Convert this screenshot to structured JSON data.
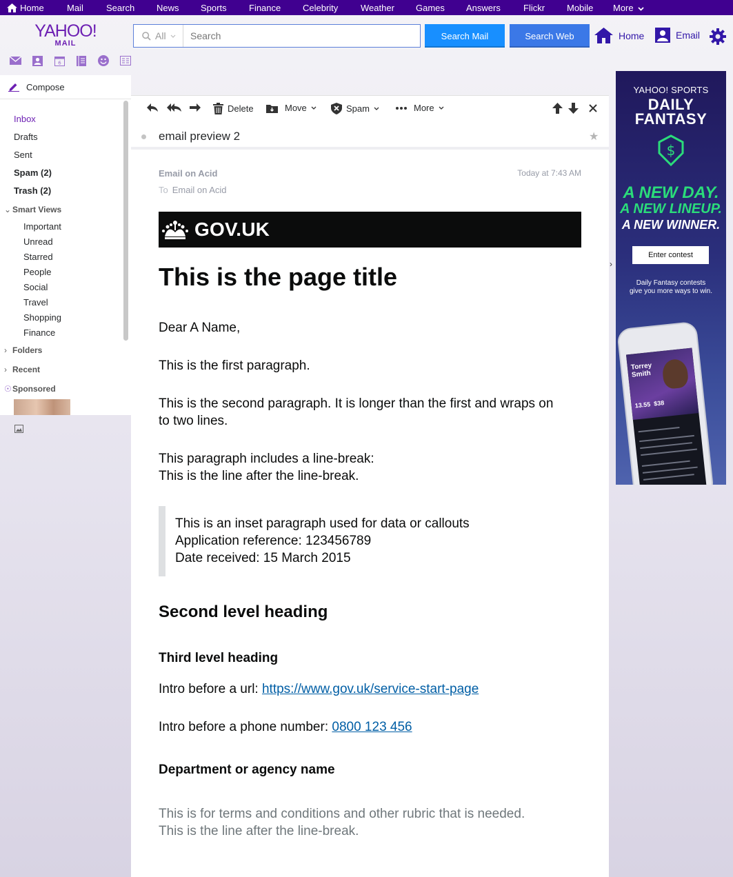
{
  "nav": {
    "items": [
      "Home",
      "Mail",
      "Search",
      "News",
      "Sports",
      "Finance",
      "Celebrity",
      "Weather",
      "Games",
      "Answers",
      "Flickr",
      "Mobile",
      "More"
    ]
  },
  "logo": {
    "line1": "YAHOO!",
    "line2": "MAIL"
  },
  "search": {
    "scope": "All",
    "placeholder": "Search",
    "value": ""
  },
  "header": {
    "search_mail": "Search Mail",
    "search_web": "Search Web",
    "home": "Home",
    "email": "Email"
  },
  "apps": [
    "mail-icon",
    "contacts-icon",
    "calendar-icon",
    "notepad-icon",
    "messenger-icon",
    "newsfeed-icon"
  ],
  "sidebar": {
    "compose": "Compose",
    "folders": [
      {
        "label": "Inbox",
        "active": true,
        "bold": false
      },
      {
        "label": "Drafts",
        "active": false,
        "bold": false
      },
      {
        "label": "Sent",
        "active": false,
        "bold": false
      },
      {
        "label": "Spam (2)",
        "active": false,
        "bold": true
      },
      {
        "label": "Trash (2)",
        "active": false,
        "bold": true
      }
    ],
    "smart_views": {
      "label": "Smart Views",
      "items": [
        "Important",
        "Unread",
        "Starred",
        "People",
        "Social",
        "Travel",
        "Shopping",
        "Finance"
      ]
    },
    "folders_section": "Folders",
    "recent_section": "Recent",
    "sponsored_section": "Sponsored"
  },
  "toolbar": {
    "delete": "Delete",
    "move": "Move",
    "spam": "Spam",
    "more": "More"
  },
  "message": {
    "subject": "email preview 2",
    "from": "Email on Acid",
    "to_label": "To",
    "to": "Email on Acid",
    "date": "Today at 7:43 AM"
  },
  "email_body": {
    "banner": "GOV.UK",
    "title": "This is the page title",
    "greeting": "Dear A Name,",
    "para1": "This is the first paragraph.",
    "para2": "This is the second paragraph. It is longer than the first and wraps on to two lines.",
    "para3_line1": "This paragraph includes a line-break:",
    "para3_line2": "This is the line after the line-break.",
    "inset_line1": "This is an inset paragraph used for data or callouts",
    "inset_line2": "Application reference: 123456789",
    "inset_line3": "Date received: 15 March 2015",
    "h2": "Second level heading",
    "h3": "Third level heading",
    "url_intro": "Intro before a url: ",
    "url": "https://www.gov.uk/service-start-page",
    "phone_intro": "Intro before a phone number: ",
    "phone": "0800 123 456",
    "department": "Department or agency name",
    "rubric_line1": "This is for terms and conditions and other rubric that is needed.",
    "rubric_line2": "This is the line after the line-break."
  },
  "ad": {
    "brand": "YAHOO! SPORTS",
    "title_line1": "DAILY",
    "title_line2": "FANTASY",
    "tag1": "A NEW DAY.",
    "tag2": "A NEW LINEUP.",
    "tag3": "A NEW WINNER.",
    "cta": "Enter contest",
    "copy_line1": "Daily Fantasy contests",
    "copy_line2": "give you more ways to win.",
    "player_first": "Torrey",
    "player_last": "Smith",
    "stat1": "13.55",
    "stat2": "$38",
    "accent": "#2bdc7a"
  },
  "colors": {
    "nav_bg": "#400090",
    "brand_purple": "#6d20b3",
    "search_mail_btn": "#188fff",
    "search_web_btn": "#3b78e7",
    "govuk_link": "#005ea5"
  }
}
